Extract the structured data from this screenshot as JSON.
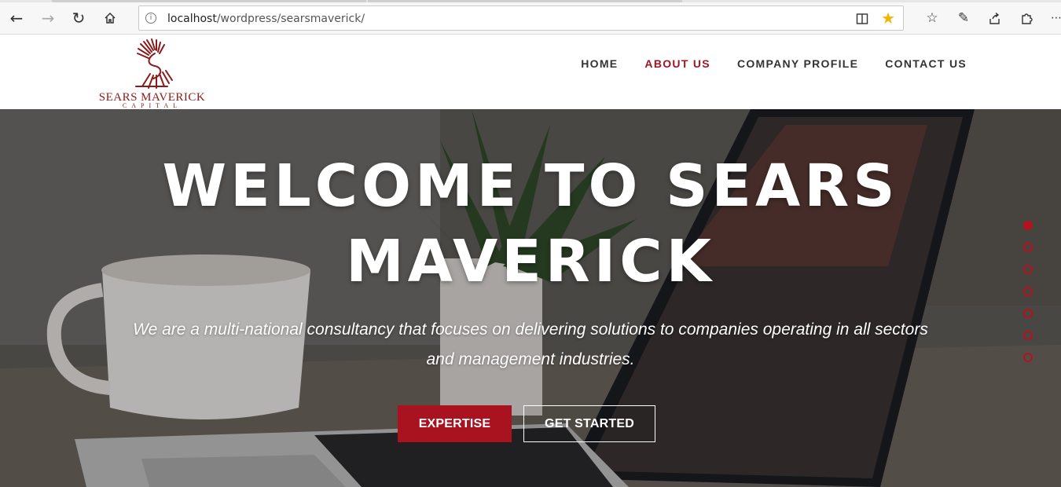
{
  "browser": {
    "back_icon": "arrow-left-icon",
    "forward_icon": "arrow-right-icon",
    "refresh_icon": "refresh-icon",
    "home_icon": "home-icon",
    "url_host": "localhost",
    "url_path": "/wordpress/searsmaverick/",
    "reading_view_icon": "book-icon",
    "favorite_icon": "star-icon",
    "toolbar_icons": [
      "favorites-icon",
      "pen-icon",
      "share-icon",
      "extensions-icon"
    ]
  },
  "site": {
    "logo_text": "SEARS MAVERICK",
    "logo_subtext": "CAPITAL",
    "nav": [
      {
        "label": "HOME",
        "active": false
      },
      {
        "label": "ABOUT US",
        "active": true
      },
      {
        "label": "COMPANY PROFILE",
        "active": false
      },
      {
        "label": "CONTACT US",
        "active": false
      }
    ]
  },
  "hero": {
    "title_line1": "WELCOME TO SEARS",
    "title_line2": "MAVERICK",
    "subtitle_line1": "We are a multi-national consultancy that focuses on delivering solutions to companies operating in all sectors",
    "subtitle_line2": "and management industries.",
    "primary_button": "EXPERTISE",
    "secondary_button": "GET STARTED",
    "slide_count": 7,
    "active_slide": 1
  },
  "colors": {
    "accent": "#a8131f",
    "nav_text": "#333333",
    "star": "#f2b600"
  }
}
